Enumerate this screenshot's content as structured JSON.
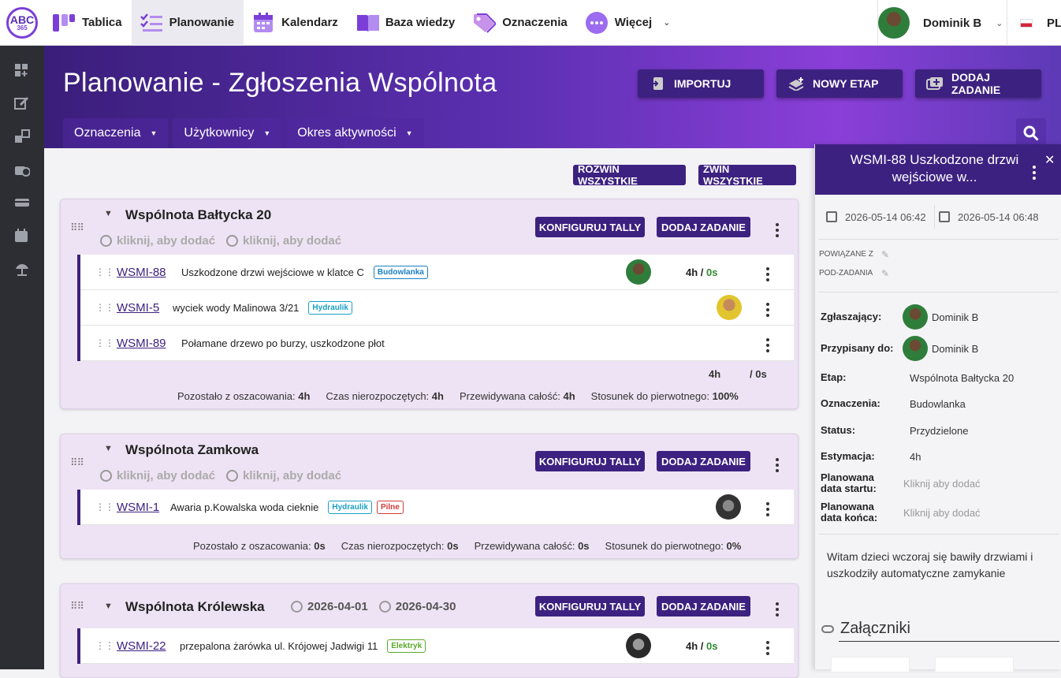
{
  "app": {
    "logo_text": "ABC",
    "logo_sub": "365"
  },
  "nav": [
    {
      "label": "Tablica",
      "icon": "board-icon"
    },
    {
      "label": "Planowanie",
      "icon": "planning-icon",
      "active": true
    },
    {
      "label": "Kalendarz",
      "icon": "calendar-icon"
    },
    {
      "label": "Baza wiedzy",
      "icon": "book-icon"
    },
    {
      "label": "Oznaczenia",
      "icon": "tag-icon"
    },
    {
      "label": "Więcej",
      "icon": "more-icon",
      "dropdown": true
    }
  ],
  "user": {
    "name": "Dominik B"
  },
  "lang": "PL",
  "sidebar": [
    "add-board-icon",
    "edit-icon",
    "move-icon",
    "time-icon",
    "card-icon",
    "calendar-icon",
    "beach-icon"
  ],
  "header": {
    "title": "Planowanie - Zgłoszenia Wspólnota",
    "import_label": "IMPORTUJ",
    "new_stage_label": "NOWY ETAP",
    "add_task_label": "DODAJ ZADANIE",
    "filters": [
      "Oznaczenia",
      "Użytkownicy",
      "Okres aktywności"
    ]
  },
  "toolbar": {
    "expand_all": "ROZWIŃ WSZYSTKIE",
    "collapse_all": "ZWIŃ WSZYSTKIE"
  },
  "group_labels": {
    "configure": "KONFIGURUJ TALLY",
    "add_task": "DODAJ ZADANIE",
    "click_to_add": "kliknij, aby dodać"
  },
  "summary_labels": {
    "remaining": "Pozostało z oszacowania:",
    "not_started": "Czas nierozpoczętych:",
    "predicted": "Przewidywana całość:",
    "ratio": "Stosunek do pierwotnego:"
  },
  "groups": [
    {
      "title": "Wspólnota Bałtycka 20",
      "tasks": [
        {
          "key": "WSMI-88",
          "title": "Uszkodzone drzwi wejściowe w klatce C",
          "tags": [
            {
              "text": "Budowlanka",
              "color": "#1a7fc4"
            }
          ],
          "est": "4h",
          "spent": "0s",
          "avatar": "green"
        },
        {
          "key": "WSMI-5",
          "title": "wyciek wody Malinowa 3/21",
          "tags": [
            {
              "text": "Hydraulik",
              "color": "#1aa0c4"
            }
          ],
          "avatar": "yellow"
        },
        {
          "key": "WSMI-89",
          "title": "Połamane drzewo po burzy, uszkodzone płot",
          "tags": []
        }
      ],
      "total_est": "4h",
      "total_spent": "/ 0s",
      "summary": {
        "remaining": "4h",
        "not_started": "4h",
        "predicted": "4h",
        "ratio": "100%"
      }
    },
    {
      "title": "Wspólnota Zamkowa",
      "tasks": [
        {
          "key": "WSMI-1",
          "title": "Awaria p.Kowalska woda cieknie",
          "tags": [
            {
              "text": "Hydraulik",
              "color": "#1aa0c4"
            },
            {
              "text": "Pilne",
              "color": "#d23a3a"
            }
          ],
          "avatar": "dark"
        }
      ],
      "summary": {
        "remaining": "0s",
        "not_started": "0s",
        "predicted": "0s",
        "ratio": "0%"
      }
    },
    {
      "title": "Wspólnota Królewska",
      "start": "2026-04-01",
      "end": "2026-04-30",
      "tasks": [
        {
          "key": "WSMI-22",
          "title": "przepalona żarówka ul. Krójowej Jadwigi 11",
          "tags": [
            {
              "text": "Elektryk",
              "color": "#5aa82a"
            }
          ],
          "est": "4h",
          "spent": "0s",
          "avatar": "dark"
        }
      ]
    }
  ],
  "panel": {
    "title": "WSMI-88 Uszkodzone drzwi wejściowe w...",
    "date1": "2026-05-14 06:42",
    "date2": "2026-05-14 06:48",
    "related_label": "POWIĄZANE Z",
    "subtasks_label": "POD-ZADANIA",
    "fields": {
      "reporter_label": "Zgłaszający:",
      "reporter": "Dominik B",
      "assignee_label": "Przypisany do:",
      "assignee": "Dominik B",
      "stage_label": "Etap:",
      "stage": "Wspólnota Bałtycka 20",
      "tags_label": "Oznaczenia:",
      "tags": "Budowlanka",
      "status_label": "Status:",
      "status": "Przydzielone",
      "estimate_label": "Estymacja:",
      "estimate": "4h",
      "start_label": "Planowana data startu:",
      "start": "Kliknij aby dodać",
      "end_label": "Planowana data końca:",
      "end": "Kliknij aby dodać"
    },
    "description": "Witam dzieci wczoraj się bawiły drzwiami i uszkodziły automatyczne zamykanie",
    "attachments_label": "Załączniki"
  }
}
